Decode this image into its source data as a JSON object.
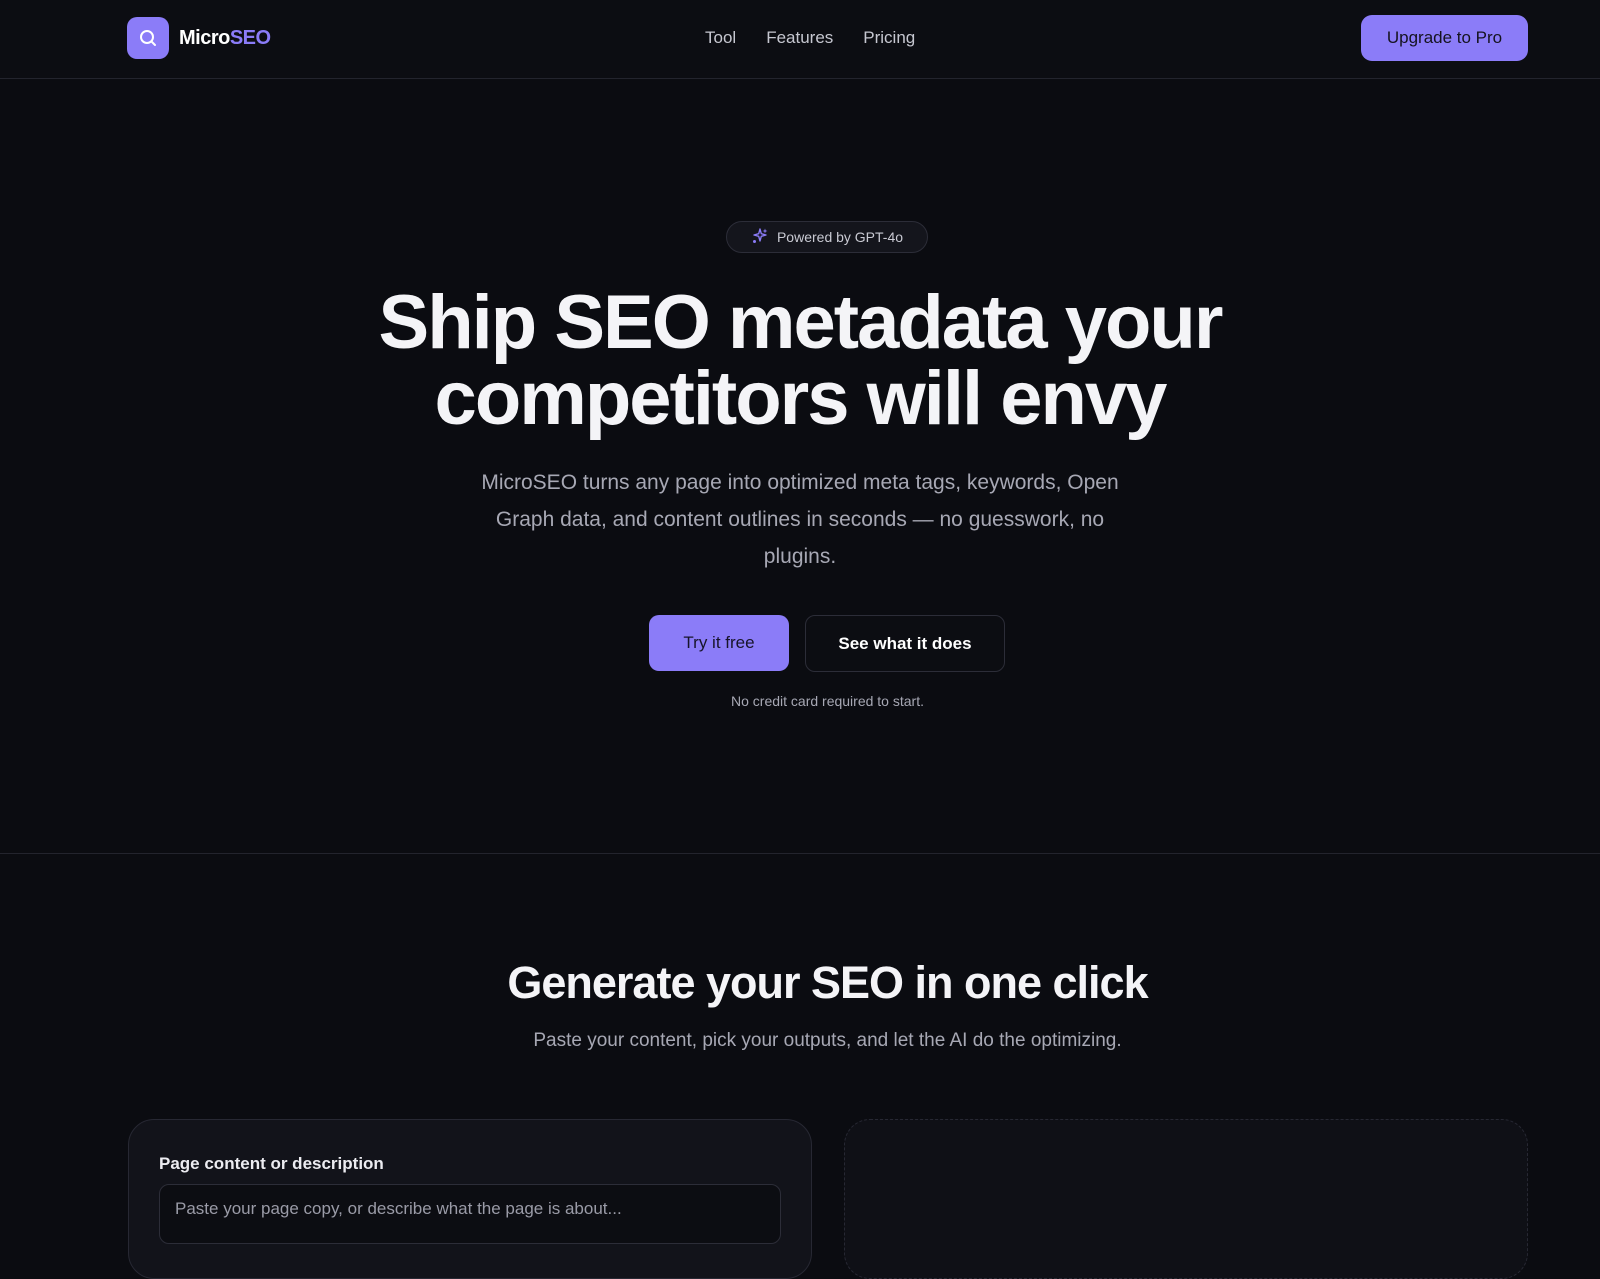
{
  "header": {
    "brand_prefix": "Micro",
    "brand_suffix": "SEO",
    "nav": [
      "Tool",
      "Features",
      "Pricing"
    ],
    "upgrade_label": "Upgrade to Pro"
  },
  "hero": {
    "badge": "Powered by GPT-4o",
    "title_line1": "Ship SEO metadata your",
    "title_line2": "competitors will envy",
    "subtitle": "MicroSEO turns any page into optimized meta tags, keywords, Open Graph data, and content outlines in seconds — no guesswork, no plugins.",
    "primary_cta": "Try it free",
    "secondary_cta": "See what it does",
    "note": "No credit card required to start."
  },
  "generator": {
    "title": "Generate your SEO in one click",
    "subtitle": "Paste your content, pick your outputs, and let the AI do the optimizing.",
    "input_label": "Page content or description",
    "input_placeholder": "Paste your page copy, or describe what the page is about..."
  },
  "colors": {
    "background": "#0b0c11",
    "accent": "#8b7cf8",
    "muted_text": "#a7a8b4",
    "border": "#23242d"
  },
  "icons": {
    "logo": "search-icon",
    "badge": "sparkles-icon"
  }
}
